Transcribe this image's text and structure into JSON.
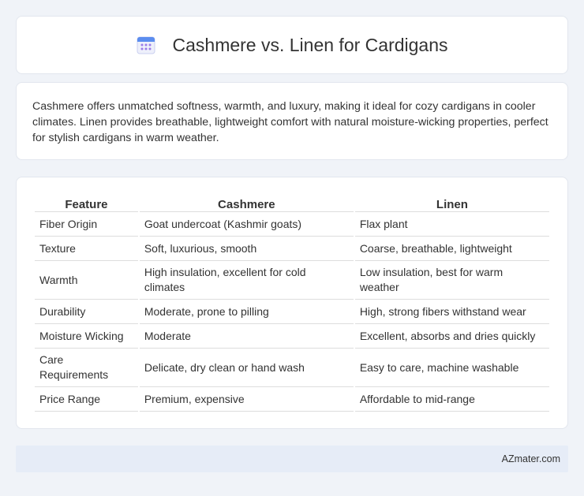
{
  "header": {
    "title": "Cashmere vs. Linen for Cardigans",
    "icon": "calendar-icon",
    "icon_colors": {
      "top": "#5b8def",
      "body": "#eef0fb",
      "dots": "#9b7be8"
    }
  },
  "summary": {
    "text": "Cashmere offers unmatched softness, warmth, and luxury, making it ideal for cozy cardigans in cooler climates. Linen provides breathable, lightweight comfort with natural moisture-wicking properties, perfect for stylish cardigans in warm weather."
  },
  "table": {
    "headers": [
      "Feature",
      "Cashmere",
      "Linen"
    ],
    "rows": [
      [
        "Fiber Origin",
        "Goat undercoat (Kashmir goats)",
        "Flax plant"
      ],
      [
        "Texture",
        "Soft, luxurious, smooth",
        "Coarse, breathable, lightweight"
      ],
      [
        "Warmth",
        "High insulation, excellent for cold climates",
        "Low insulation, best for warm weather"
      ],
      [
        "Durability",
        "Moderate, prone to pilling",
        "High, strong fibers withstand wear"
      ],
      [
        "Moisture Wicking",
        "Moderate",
        "Excellent, absorbs and dries quickly"
      ],
      [
        "Care Requirements",
        "Delicate, dry clean or hand wash",
        "Easy to care, machine washable"
      ],
      [
        "Price Range",
        "Premium, expensive",
        "Affordable to mid-range"
      ]
    ]
  },
  "footer": {
    "source": "AZmater.com"
  }
}
